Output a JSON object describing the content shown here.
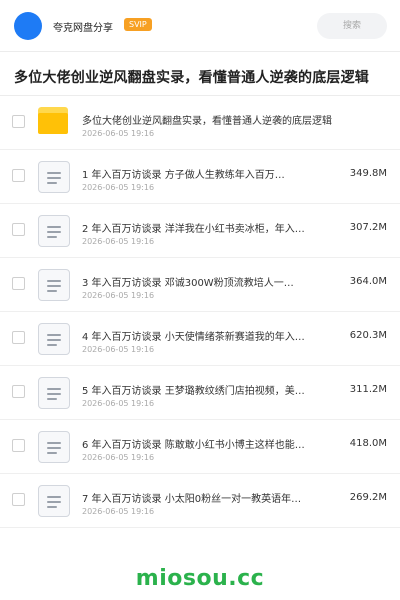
{
  "header": {
    "share_name": "夸克网盘分享",
    "badge": "SVIP",
    "search_placeholder": "搜索",
    "accent_color": "#1e7bf5"
  },
  "title": "多位大佬创业逆风翻盘实录，看懂普通人逆袭的底层逻辑",
  "files": [
    {
      "type": "folder",
      "icon": "folder-icon",
      "name": "多位大佬创业逆风翻盘实录，看懂普通人逆袭的底层逻辑",
      "date": "2026-06-05 19:16",
      "size": ""
    },
    {
      "type": "doc",
      "icon": "document-icon",
      "name": "1  年入百万访谈录  方子做人生教练年入百万…",
      "date": "2026-06-05 19:16",
      "size": "349.8M"
    },
    {
      "type": "doc",
      "icon": "document-icon",
      "name": "2  年入百万访谈录  洋洋我在小红书卖冰柜，年入…",
      "date": "2026-06-05 19:16",
      "size": "307.2M"
    },
    {
      "type": "doc",
      "icon": "document-icon",
      "name": "3  年入百万访谈录  邓诚300W粉顶流教培人一…",
      "date": "2026-06-05 19:16",
      "size": "364.0M"
    },
    {
      "type": "doc",
      "icon": "document-icon",
      "name": "4  年入百万访谈录  小天使情绪茶新赛道我的年入…",
      "date": "2026-06-05 19:16",
      "size": "620.3M"
    },
    {
      "type": "doc",
      "icon": "document-icon",
      "name": "5  年入百万访谈录  王梦璐教纹绣门店拍视频，美…",
      "date": "2026-06-05 19:16",
      "size": "311.2M"
    },
    {
      "type": "doc",
      "icon": "document-icon",
      "name": "6  年入百万访谈录  陈敢敢小红书小博主这样也能…",
      "date": "2026-06-05 19:16",
      "size": "418.0M"
    },
    {
      "type": "doc",
      "icon": "document-icon",
      "name": "7  年入百万访谈录  小太阳0粉丝一对一教英语年…",
      "date": "2026-06-05 19:16",
      "size": "269.2M"
    }
  ],
  "watermark": "miosou.cc",
  "watermark_color": "#2bb24c"
}
